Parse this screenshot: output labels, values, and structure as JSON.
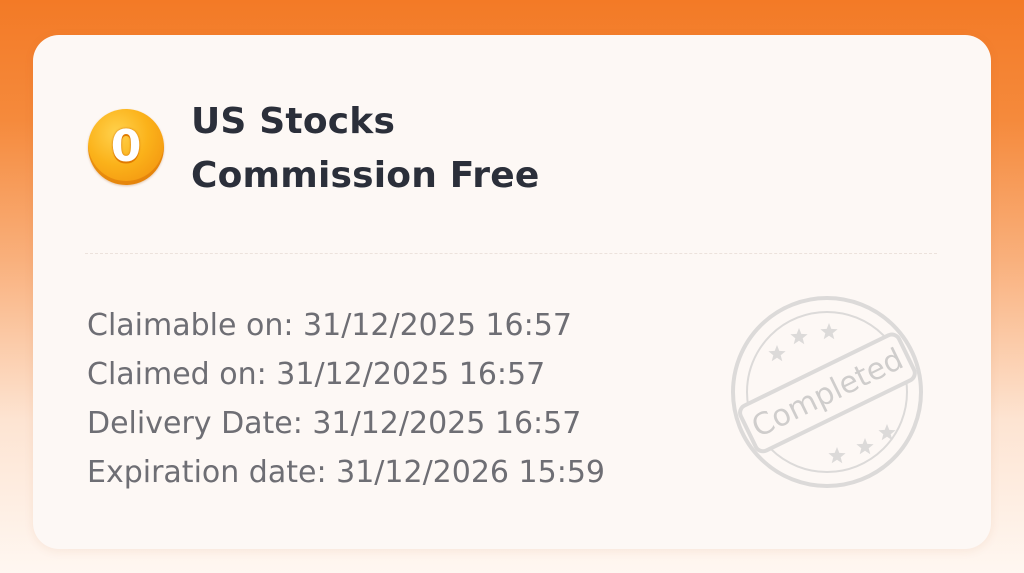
{
  "coupon": {
    "icon": "gold-coin-zero-icon",
    "icon_glyph": "0",
    "title_line1": "US Stocks",
    "title_line2": "Commission Free",
    "details": [
      {
        "label": "Claimable on:",
        "value": "31/12/2025 16:57"
      },
      {
        "label": "Claimed on:",
        "value": "31/12/2025 16:57"
      },
      {
        "label": "Delivery Date:",
        "value": "31/12/2025 16:57"
      },
      {
        "label": "Expiration date:",
        "value": "31/12/2026 15:59"
      }
    ],
    "stamp_text": "Completed"
  },
  "colors": {
    "background_top": "#f37a26",
    "card": "#fdf8f5",
    "title": "#2b2f3a",
    "detail_text": "#6e6e74",
    "stamp": "#d9d7d6",
    "coin": "#fbb21a"
  }
}
